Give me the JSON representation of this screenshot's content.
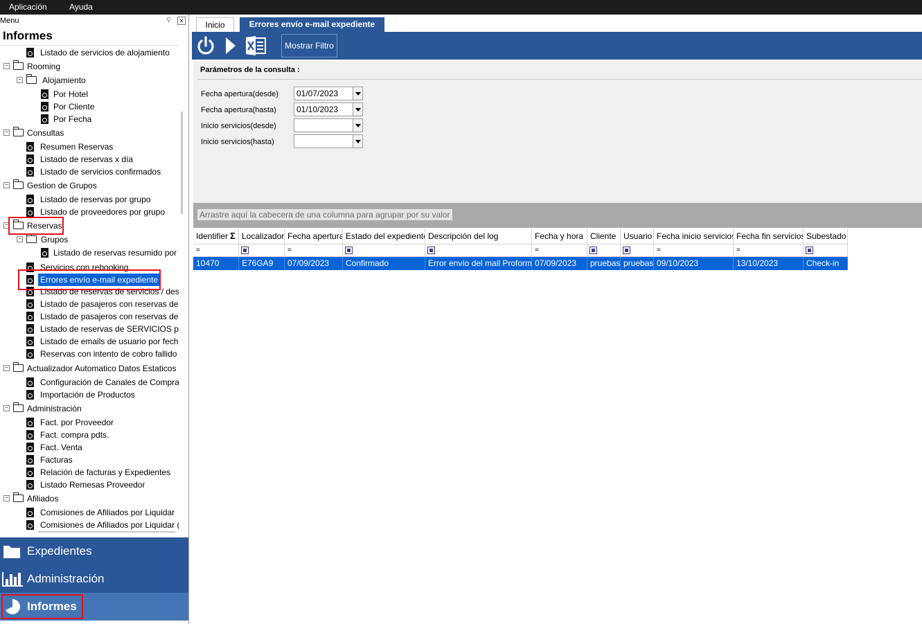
{
  "menubar": {
    "app": "Aplicación",
    "help": "Ayuda"
  },
  "left_panel": {
    "menu_label": "Menu",
    "title": "Informes",
    "tree": [
      {
        "label": "Listado de servicios de alojamiento",
        "kind": "report"
      },
      {
        "label": "Rooming",
        "kind": "folder"
      },
      {
        "label": "Alojamiento",
        "kind": "folder"
      },
      {
        "label": "Por Hotel",
        "kind": "report"
      },
      {
        "label": "Por Cliente",
        "kind": "report"
      },
      {
        "label": "Por Fecha",
        "kind": "report"
      },
      {
        "label": "Consultas",
        "kind": "folder"
      },
      {
        "label": "Resumen Reservas",
        "kind": "report"
      },
      {
        "label": "Listado de reservas x día",
        "kind": "report"
      },
      {
        "label": "Listado de servicios confirmados",
        "kind": "report"
      },
      {
        "label": "Gestion de Grupos",
        "kind": "folder"
      },
      {
        "label": "Listado de reservas por grupo",
        "kind": "report"
      },
      {
        "label": "Listado de proveedores por grupo",
        "kind": "report"
      },
      {
        "label": "Reservas",
        "kind": "folder"
      },
      {
        "label": "Grupos",
        "kind": "folder"
      },
      {
        "label": "Listado de reservas resumido por",
        "kind": "report"
      },
      {
        "label": "Servicios con rebooking",
        "kind": "report"
      },
      {
        "label": "Errores envío e-mail expediente",
        "kind": "report",
        "selected": true
      },
      {
        "label": "Listado de reservas de servicios / des",
        "kind": "report"
      },
      {
        "label": "Listado de pasajeros con reservas de",
        "kind": "report"
      },
      {
        "label": "Listado de pasajeros con reservas de",
        "kind": "report"
      },
      {
        "label": "Listado de reservas de SERVICIOS p",
        "kind": "report"
      },
      {
        "label": "Listado de emails de usuario por fecha",
        "kind": "report"
      },
      {
        "label": "Reservas con intento de cobro fallido",
        "kind": "report"
      },
      {
        "label": "Actualizador Automatico Datos Estaticos",
        "kind": "folder"
      },
      {
        "label": "Configuración de Canales de Compra",
        "kind": "report"
      },
      {
        "label": "Importación de Productos",
        "kind": "report"
      },
      {
        "label": "Administración",
        "kind": "folder"
      },
      {
        "label": "Fact. por Proveedor",
        "kind": "report"
      },
      {
        "label": "Fact. compra pdts.",
        "kind": "report"
      },
      {
        "label": "Fact. Venta",
        "kind": "report"
      },
      {
        "label": "Facturas",
        "kind": "report"
      },
      {
        "label": "Relación de facturas y Expedientes",
        "kind": "report"
      },
      {
        "label": "Listado Remesas Proveedor",
        "kind": "report"
      },
      {
        "label": "Afiliados",
        "kind": "folder"
      },
      {
        "label": "Comisiones de Afiliados por Liquidar",
        "kind": "report"
      },
      {
        "label": "Comisiones de Afiliados por Liquidar (",
        "kind": "report"
      }
    ]
  },
  "nav": {
    "expedientes": "Expedientes",
    "administracion": "Administración",
    "informes": "Informes"
  },
  "tabs": {
    "inicio": "Inicio",
    "active": "Errores envío e-mail expediente"
  },
  "toolbar": {
    "filter_button": "Mostrar Filtro",
    "icons": [
      "power-icon",
      "play-icon",
      "excel-icon"
    ]
  },
  "params": {
    "title": "Parámetros de la consulta :",
    "fields": [
      {
        "label": "Fecha apertura(desde)",
        "value": "01/07/2023"
      },
      {
        "label": "Fecha apertura(hasta)",
        "value": "01/10/2023"
      },
      {
        "label": "Inicio servicios(desde)",
        "value": ""
      },
      {
        "label": "Inicio servicios(hasta)",
        "value": ""
      }
    ]
  },
  "grid": {
    "group_hint": "Arrastre aquí la cabecera de una columna para agrupar por su valor",
    "columns": [
      "Identifier",
      "Localizador",
      "Fecha apertura",
      "Estado del expediente",
      "Descripción del log",
      "Fecha y hora",
      "Cliente",
      "Usuario",
      "Fecha inicio servicios",
      "Fecha fin servicios",
      "Subestado"
    ],
    "rows": [
      [
        "10470",
        "E76GA9",
        "07/09/2023",
        "Confirmado",
        "Error envío del mail Proforma.",
        "07/09/2023",
        "pruebas",
        "pruebas",
        "09/10/2023",
        "13/10/2023",
        "Check-in"
      ]
    ]
  },
  "colors": {
    "accent": "#2b5798",
    "selection": "#0a64d8",
    "highlight_box": "#e4121c"
  }
}
